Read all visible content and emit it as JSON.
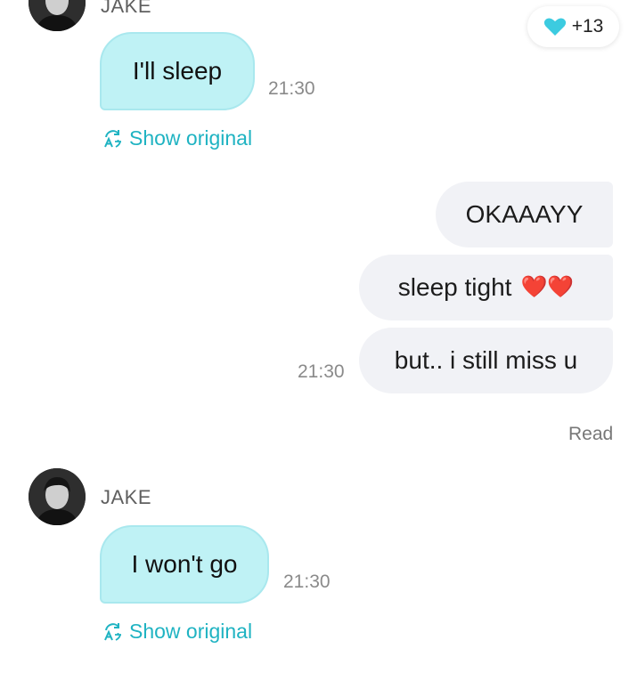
{
  "colors": {
    "incoming_bubble": "#bff2f5",
    "outgoing_bubble": "#f1f2f6",
    "accent": "#1fb3c2",
    "reaction_heart": "#3ccbe0"
  },
  "reaction": {
    "icon": "heart-icon",
    "count": "+13"
  },
  "messages": {
    "m1": {
      "sender": "JAKE",
      "text": "I'll sleep",
      "time": "21:30",
      "show_original": "Show original"
    },
    "out": {
      "bubbles": [
        "OKAAAYY",
        "sleep tight",
        "but.. i still miss u"
      ],
      "emoji": "❤️❤️",
      "time": "21:30",
      "status": "Read"
    },
    "m2": {
      "sender": "JAKE",
      "text": "I won't go",
      "time": "21:30",
      "show_original": "Show original"
    }
  }
}
